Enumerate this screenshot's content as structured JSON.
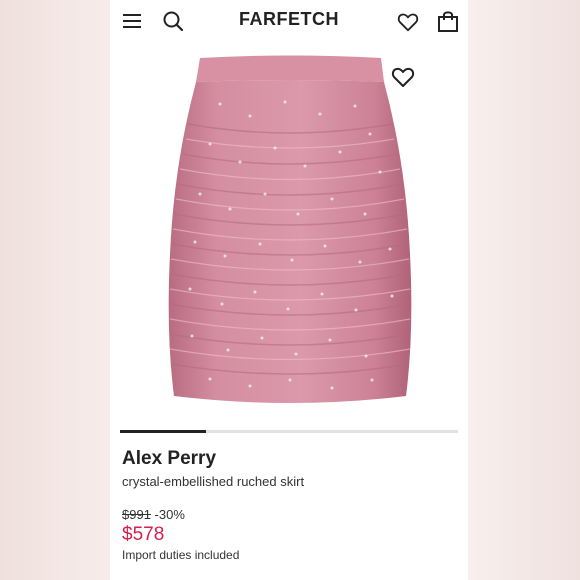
{
  "header": {
    "logo": "FARFETCH",
    "icons": [
      "menu-icon",
      "search-icon",
      "wishlist-icon",
      "bag-icon"
    ]
  },
  "product": {
    "brand": "Alex Perry",
    "name": "crystal-embellished ruched skirt",
    "original_price": "$991",
    "discount": "-30%",
    "price": "$578",
    "duties_note": "Import duties included",
    "image_description": "pink ruched mini skirt with crystal embellishments"
  },
  "carousel": {
    "active_index": 1,
    "progress": 0.25
  },
  "colors": {
    "accent_price": "#d81f4b",
    "skirt_pink": "#d3869c",
    "text": "#222222"
  }
}
